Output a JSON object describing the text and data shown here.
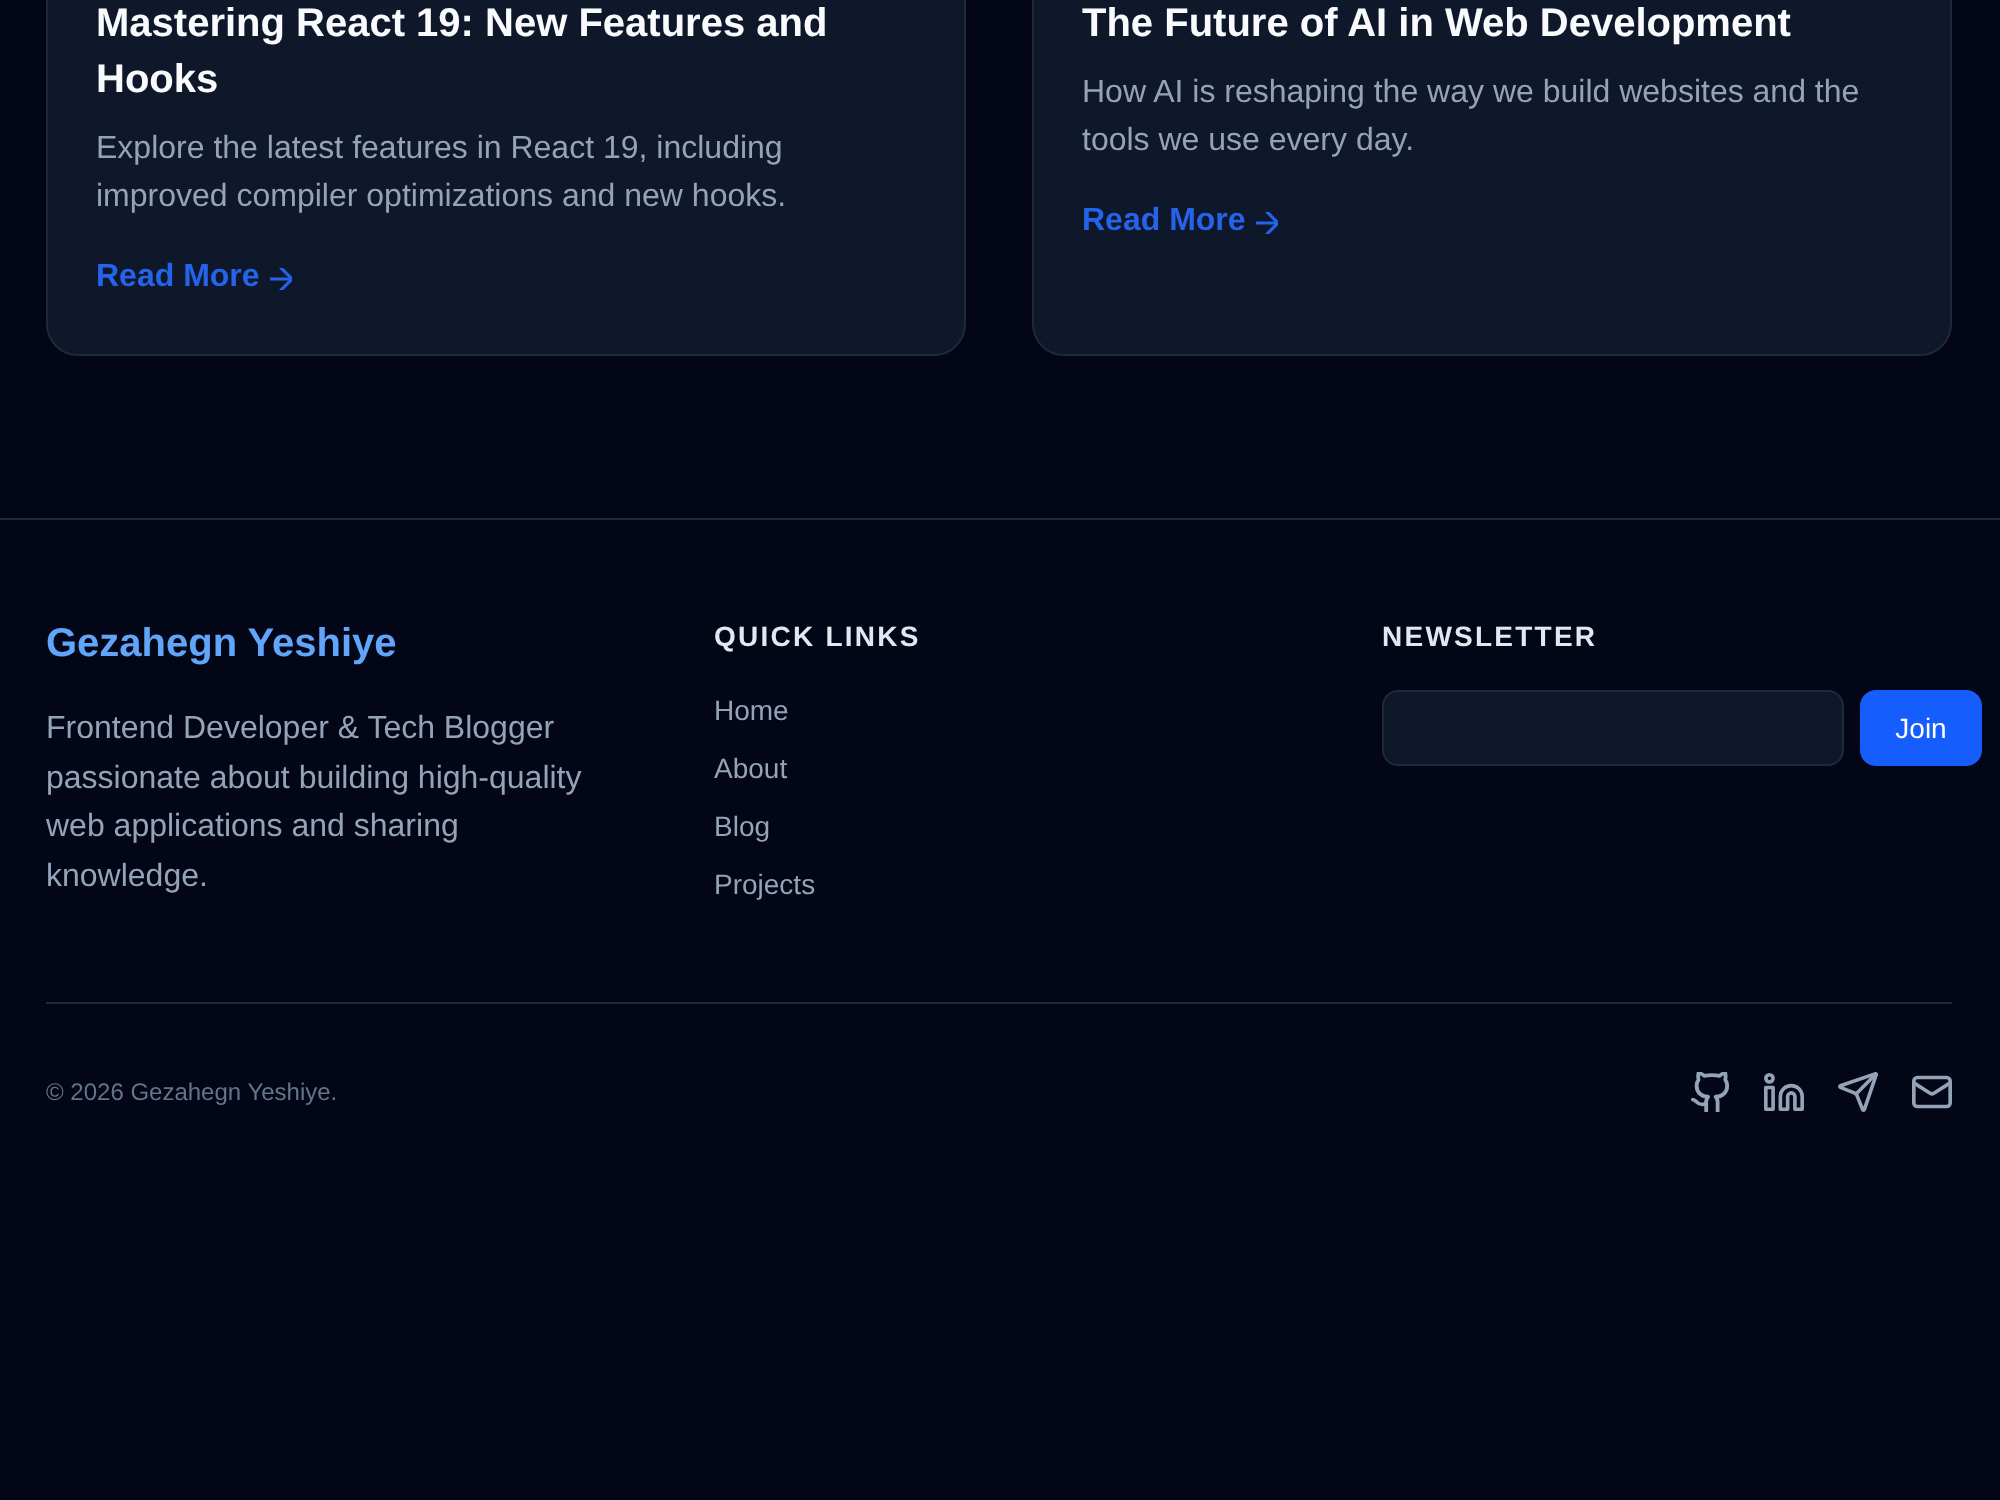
{
  "posts": [
    {
      "title": "Mastering React 19: New Features and Hooks",
      "excerpt": "Explore the latest features in React 19, including improved compiler optimizations and new hooks.",
      "link": "Read More"
    },
    {
      "title": "The Future of AI in Web Development",
      "excerpt": "How AI is reshaping the way we build websites and the tools we use every day.",
      "link": "Read More"
    }
  ],
  "footer": {
    "brand": "Gezahegn Yeshiye",
    "bio": "Frontend Developer & Tech Blogger passionate about building high-quality web applications and sharing knowledge.",
    "quick_links": {
      "heading": "QUICK LINKS",
      "items": [
        "Home",
        "About",
        "Blog",
        "Projects"
      ]
    },
    "newsletter": {
      "heading": "NEWSLETTER",
      "button": "Join"
    },
    "copyright": "© 2026 Gezahegn Yeshiye.",
    "social": [
      {
        "kind": "github"
      },
      {
        "kind": "linkedin"
      },
      {
        "kind": "send"
      },
      {
        "kind": "mail"
      }
    ]
  }
}
